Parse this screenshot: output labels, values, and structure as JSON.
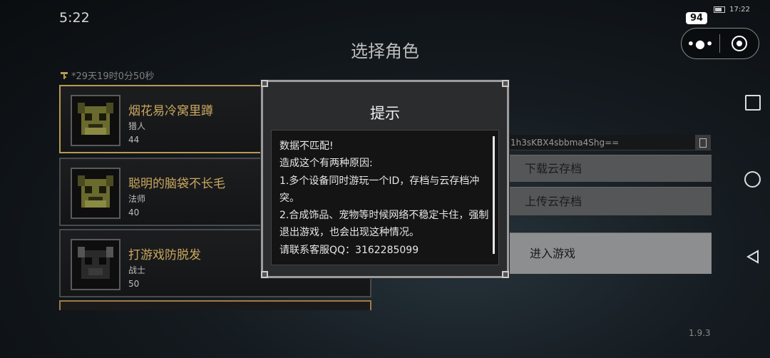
{
  "status": {
    "time": "5:22",
    "clock_right": "17:22",
    "battery": "94"
  },
  "page": {
    "title": "选择角色",
    "timer": "*29天19时0分50秒",
    "version": "1.9.3"
  },
  "characters": [
    {
      "name": "烟花易冷窝里蹲",
      "class": "猎人",
      "level": "44"
    },
    {
      "name": "聪明的脑袋不长毛",
      "class": "法师",
      "level": "40"
    },
    {
      "name": "打游戏防脱发",
      "class": "战士",
      "level": "50"
    }
  ],
  "cloud": {
    "code": "1h3sKBX4sbbma4Shg==",
    "download_label": "下载云存档",
    "upload_label": "上传云存档",
    "enter_label": "进入游戏"
  },
  "dialog": {
    "title": "提示",
    "lines": [
      "数据不匹配!",
      "造成这个有两种原因:",
      "1.多个设备同时游玩一个ID，存档与云存档冲突。",
      "2.合成饰品、宠物等时候网络不稳定卡住，强制退出游戏，也会出现这种情况。",
      "请联系客服QQ：3162285099"
    ]
  },
  "icons": [
    "key-icon",
    "more-icon",
    "target-icon",
    "copy-icon",
    "nav-square-icon",
    "nav-circle-icon",
    "nav-back-icon",
    "battery-icon"
  ],
  "colors": {
    "gold": "#c9a85e",
    "selected_border": "#b89a52",
    "button": "#555657",
    "enter_button": "#8d8e8f"
  }
}
